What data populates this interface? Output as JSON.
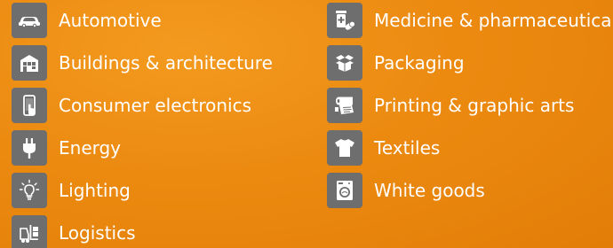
{
  "industries": {
    "left": [
      {
        "label": "Automotive",
        "icon": "car-icon"
      },
      {
        "label": "Buildings & architecture",
        "icon": "building-icon"
      },
      {
        "label": "Consumer electronics",
        "icon": "smartphone-touch-icon"
      },
      {
        "label": "Energy",
        "icon": "plug-icon"
      },
      {
        "label": "Lighting",
        "icon": "light-bulb-icon"
      },
      {
        "label": "Logistics",
        "icon": "forklift-icon"
      }
    ],
    "right": [
      {
        "label": "Medicine & pharmaceutical",
        "icon": "medicine-icon"
      },
      {
        "label": "Packaging",
        "icon": "box-icon"
      },
      {
        "label": "Printing & graphic arts",
        "icon": "printing-roll-icon"
      },
      {
        "label": "Textiles",
        "icon": "t-shirt-icon"
      },
      {
        "label": "White goods",
        "icon": "washing-machine-icon"
      }
    ]
  },
  "colors": {
    "background": "#ec8a10",
    "icon_box": "#6e6e6e",
    "text": "#ffffff"
  }
}
